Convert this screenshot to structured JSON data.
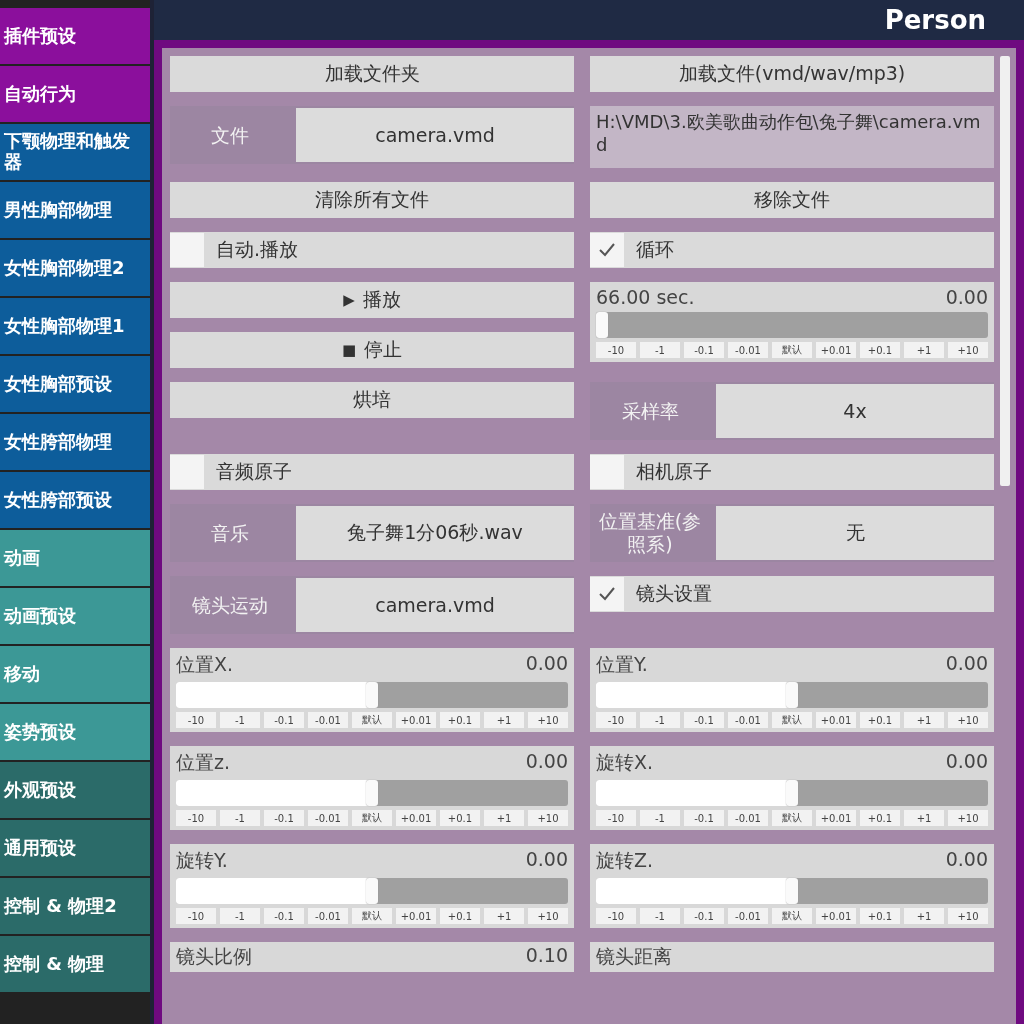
{
  "header": {
    "title": "Person"
  },
  "sidebar": {
    "items": [
      {
        "label": "插件预设",
        "color": "#8b0f9c"
      },
      {
        "label": "自动行为",
        "color": "#8b0f9c"
      },
      {
        "label": "下颚物理和触发器",
        "color": "#0d5d9b"
      },
      {
        "label": "男性胸部物理",
        "color": "#0d5d9b"
      },
      {
        "label": "女性胸部物理2",
        "color": "#0d5d9b"
      },
      {
        "label": "女性胸部物理1",
        "color": "#0d5d9b"
      },
      {
        "label": "女性胸部预设",
        "color": "#0d5d9b"
      },
      {
        "label": "女性胯部物理",
        "color": "#0d5d9b"
      },
      {
        "label": "女性胯部预设",
        "color": "#0d5d9b"
      },
      {
        "label": "动画",
        "color": "#3c9896"
      },
      {
        "label": "动画预设",
        "color": "#3c9896"
      },
      {
        "label": "移动",
        "color": "#3c9896"
      },
      {
        "label": "姿势预设",
        "color": "#3c9896"
      },
      {
        "label": "外观预设",
        "color": "#2b6b69"
      },
      {
        "label": "通用预设",
        "color": "#2b6b69"
      },
      {
        "label": "控制 & 物理2",
        "color": "#2b6b69"
      },
      {
        "label": "控制 & 物理",
        "color": "#2b6b69"
      }
    ]
  },
  "rows": [
    {
      "left": [
        {
          "kind": "button",
          "label": "加载文件夹"
        }
      ],
      "right": [
        {
          "kind": "button",
          "label": "加载文件(vmd/wav/mp3)"
        }
      ]
    },
    {
      "left": [
        {
          "kind": "field",
          "label": "文件",
          "value": "camera.vmd"
        }
      ],
      "right": [
        {
          "kind": "path",
          "value": "H:\\VMD\\3.欧美歌曲动作包\\兔子舞\\camera.vmd"
        }
      ]
    },
    {
      "left": [
        {
          "kind": "button",
          "label": "清除所有文件"
        }
      ],
      "right": [
        {
          "kind": "button",
          "label": "移除文件"
        }
      ]
    },
    {
      "left": [
        {
          "kind": "checkbox",
          "label": "自动.播放",
          "checked": false
        }
      ],
      "right": [
        {
          "kind": "checkbox",
          "label": "循环",
          "checked": true
        }
      ]
    },
    {
      "left": [
        {
          "kind": "button",
          "icon": "▶",
          "label": "播放"
        },
        {
          "kind": "button",
          "icon": "■",
          "label": "停止"
        }
      ],
      "right": [
        {
          "kind": "slider",
          "label": "66.00 sec.",
          "value": "0.00",
          "level": 0,
          "ticks": [
            "-10",
            "-1",
            "-0.1",
            "-0.01",
            "默认",
            "+0.01",
            "+0.1",
            "+1",
            "+10"
          ]
        }
      ]
    },
    {
      "left": [
        {
          "kind": "button",
          "label": "烘培"
        }
      ],
      "right": [
        {
          "kind": "field",
          "label": "采样率",
          "value": "4x"
        }
      ]
    },
    {
      "left": [
        {
          "kind": "checkbox",
          "label": "音频原子",
          "checked": false
        }
      ],
      "right": [
        {
          "kind": "checkbox",
          "label": "相机原子",
          "checked": false
        }
      ]
    },
    {
      "left": [
        {
          "kind": "field",
          "label": "音乐",
          "value": "兔子舞1分06秒.wav"
        }
      ],
      "right": [
        {
          "kind": "field",
          "label": "位置基准(参照系)",
          "value": "无"
        }
      ]
    },
    {
      "left": [
        {
          "kind": "field",
          "label": "镜头运动",
          "value": "camera.vmd"
        }
      ],
      "right": [
        {
          "kind": "checkbox",
          "label": "镜头设置",
          "checked": true
        }
      ]
    },
    {
      "left": [
        {
          "kind": "slider",
          "label": "位置X.",
          "value": "0.00",
          "level": 0.5,
          "ticks": [
            "-10",
            "-1",
            "-0.1",
            "-0.01",
            "默认",
            "+0.01",
            "+0.1",
            "+1",
            "+10"
          ]
        }
      ],
      "right": [
        {
          "kind": "slider",
          "label": "位置Y.",
          "value": "0.00",
          "level": 0.5,
          "ticks": [
            "-10",
            "-1",
            "-0.1",
            "-0.01",
            "默认",
            "+0.01",
            "+0.1",
            "+1",
            "+10"
          ]
        }
      ]
    },
    {
      "left": [
        {
          "kind": "slider",
          "label": "位置z.",
          "value": "0.00",
          "level": 0.5,
          "ticks": [
            "-10",
            "-1",
            "-0.1",
            "-0.01",
            "默认",
            "+0.01",
            "+0.1",
            "+1",
            "+10"
          ]
        }
      ],
      "right": [
        {
          "kind": "slider",
          "label": "旋转X.",
          "value": "0.00",
          "level": 0.5,
          "ticks": [
            "-10",
            "-1",
            "-0.1",
            "-0.01",
            "默认",
            "+0.01",
            "+0.1",
            "+1",
            "+10"
          ]
        }
      ]
    },
    {
      "left": [
        {
          "kind": "slider",
          "label": "旋转Y.",
          "value": "0.00",
          "level": 0.5,
          "ticks": [
            "-10",
            "-1",
            "-0.1",
            "-0.01",
            "默认",
            "+0.01",
            "+0.1",
            "+1",
            "+10"
          ]
        }
      ],
      "right": [
        {
          "kind": "slider",
          "label": "旋转Z.",
          "value": "0.00",
          "level": 0.5,
          "ticks": [
            "-10",
            "-1",
            "-0.1",
            "-0.01",
            "默认",
            "+0.01",
            "+0.1",
            "+1",
            "+10"
          ]
        }
      ]
    },
    {
      "left": [
        {
          "kind": "heading",
          "label": "镜头比例",
          "value": "0.10"
        }
      ],
      "right": [
        {
          "kind": "heading",
          "label": "镜头距离"
        }
      ]
    }
  ]
}
